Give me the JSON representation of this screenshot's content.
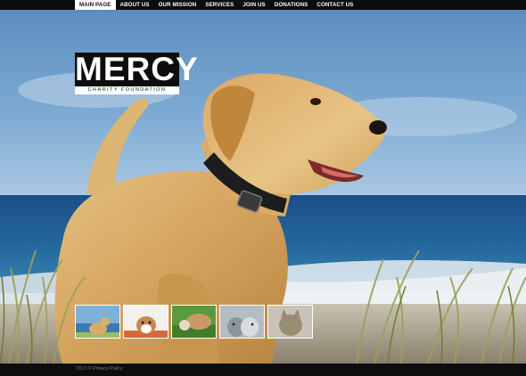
{
  "nav": {
    "items": [
      {
        "label": "MAIN PAGE",
        "active": true
      },
      {
        "label": "ABOUT US",
        "active": false
      },
      {
        "label": "OUR MISSION",
        "active": false
      },
      {
        "label": "SERVICES",
        "active": false
      },
      {
        "label": "JOIN US",
        "active": false
      },
      {
        "label": "DONATIONS",
        "active": false
      },
      {
        "label": "CONTACT US",
        "active": false
      }
    ]
  },
  "logo": {
    "title": "MERCY",
    "subtitle": "CHARITY FOUNDATION"
  },
  "thumbnails": [
    {
      "icon": "dog-beach-thumb"
    },
    {
      "icon": "puppy-thumb"
    },
    {
      "icon": "dog-grass-thumb"
    },
    {
      "icon": "kittens-thumb"
    },
    {
      "icon": "cat-thumb"
    }
  ],
  "footer": {
    "copyright": "2013 ©",
    "link": "Privacy Policy"
  },
  "colors": {
    "nav_bg": "#0c0c0c",
    "nav_active_bg": "#ffffff",
    "logo_bg": "#0d0d0d",
    "footer_bg": "#0e0e0e"
  }
}
